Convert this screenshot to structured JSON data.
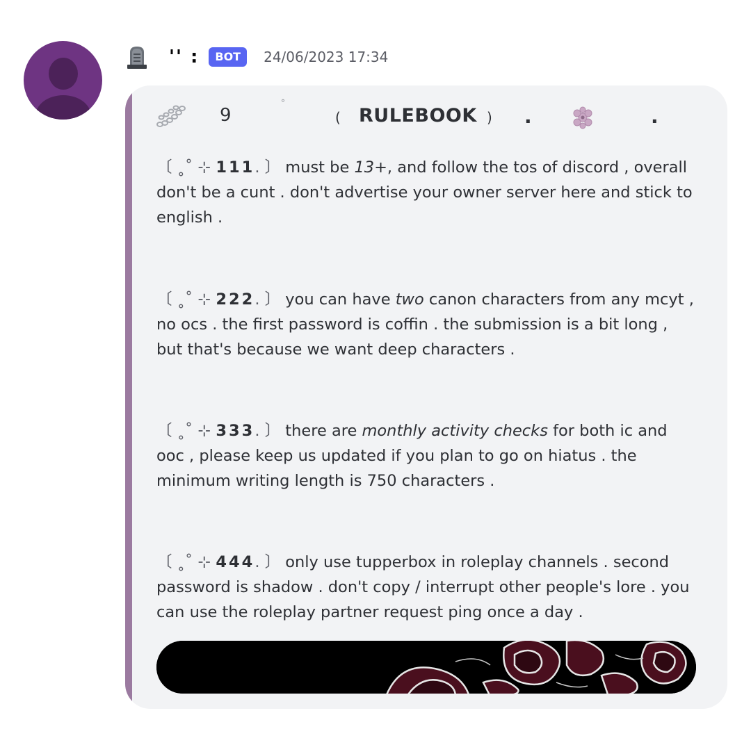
{
  "message": {
    "author": {
      "name": "'' :",
      "badge": "BOT",
      "avatar_icon": "default-avatar-icon",
      "name_icon": "gravestone-icon"
    },
    "timestamp": "24/06/2023 17:34"
  },
  "embed": {
    "accent_color": "#9b7aa0",
    "title": {
      "icon_left": "chain-icon",
      "number": "9",
      "star": "°",
      "paren_open": "(",
      "text": "RULEBOOK",
      "paren_close": ")",
      "dot1": ".",
      "icon_right": "flower-icon",
      "dot2": "."
    },
    "rules": [
      {
        "open": "〔",
        "deco": "˳˚ ⊹",
        "number": "111",
        "close": ". 〕",
        "before": "must be ",
        "italic": "13+",
        "after": ", and follow the tos of discord , overall don't be a cunt . don't advertise your owner server here and stick to english ."
      },
      {
        "open": "〔",
        "deco": "˳˚ ⊹",
        "number": "222",
        "close": ". 〕",
        "before": "you can have ",
        "italic": "two",
        "after": " canon characters from any mcyt , no ocs . the first password is coffin . the submission is a bit long , but that's because we want deep characters ."
      },
      {
        "open": "〔",
        "deco": "˳˚ ⊹",
        "number": "333",
        "close": ". 〕",
        "before": "there are ",
        "italic": "monthly activity checks",
        "after": " for both ic and ooc , please keep us updated if you plan to go on hiatus . the minimum writing length is 750 characters ."
      },
      {
        "open": "〔",
        "deco": "˳˚ ⊹",
        "number": "444",
        "close": ". 〕",
        "before": "only use tupperbox in roleplay channels  . second password is shadow . don't copy / interrupt other people's lore . you can use the roleplay partner request ping once a day .",
        "italic": "",
        "after": ""
      }
    ],
    "banner_image": "dark-roses-banner"
  }
}
